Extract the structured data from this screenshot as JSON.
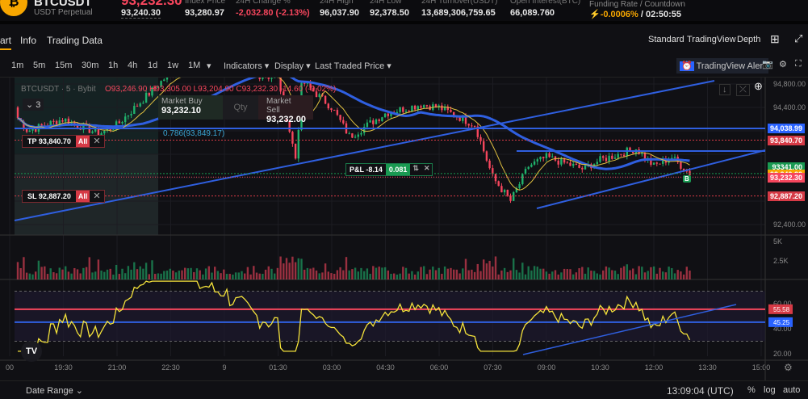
{
  "header": {
    "symbol": "BTCUSDT",
    "contract": "USDT Perpetual",
    "last_price": "93,232.30",
    "mark_price": "93,240.30",
    "stats": [
      {
        "label": "Index Price",
        "value": "93,280.97"
      },
      {
        "label": "24H Change %",
        "value": "-2,032.80 (-2.13%)"
      },
      {
        "label": "24H High",
        "value": "96,037.90"
      },
      {
        "label": "24H Low",
        "value": "92,378.50"
      },
      {
        "label": "24H Turnover(USDT)",
        "value": "13,689,306,759.65"
      },
      {
        "label": "Open Interest(BTC)",
        "value": "66,089.760"
      }
    ],
    "funding_label": "Funding Rate / Countdown",
    "funding_rate": "-0.0006%",
    "countdown": "/ 02:50:55"
  },
  "tabs": {
    "items": [
      "art",
      "Info",
      "Trading Data"
    ],
    "views": [
      "Standard",
      "TradingView",
      "Depth"
    ],
    "active_view": "TradingView"
  },
  "toolbar": {
    "intervals": [
      "1m",
      "5m",
      "15m",
      "30m",
      "1h",
      "4h",
      "1d",
      "1w",
      "1M"
    ],
    "active_interval": "5m",
    "menus": [
      "Indicators",
      "Display",
      "Last Traded Price"
    ],
    "alert": "TradingView Alert"
  },
  "legend": {
    "symbol": "BTCUSDT · 5 · Bybit",
    "ohlc": "O93,246.90 H93,305.00 L93,204.90 C93,232.30 -14.60 (-0.02%)",
    "collapse": "3"
  },
  "order": {
    "buy_label": "Market Buy",
    "buy_price": "93,232.10",
    "qty": "Qty",
    "sell_label": "Market Sell",
    "sell_price": "93,232.00"
  },
  "lines": {
    "fib": "0.786(93,849.17)",
    "tp": "TP 93,840.70",
    "sl": "SL 92,887.20",
    "all": "All",
    "pnl_label": "P&L -8.14",
    "pnl_qty": "0.081",
    "b_marker": "B"
  },
  "price_labels": [
    {
      "v": "94,038.99",
      "c": "#2962ff",
      "p": 94038.99
    },
    {
      "v": "93,840.70",
      "c": "#d63a46",
      "p": 93840.7
    },
    {
      "v": "93341.00",
      "c": "#1a9a52",
      "p": 93380
    },
    {
      "v": "93,240.30",
      "c": "#f7a600",
      "p": 93255
    },
    {
      "v": "93,232.30",
      "c": "#f6465d",
      "p": 93195
    },
    {
      "v": "92,887.20",
      "c": "#d63a46",
      "p": 92887.2
    }
  ],
  "colors": {
    "up": "#20b26c",
    "down": "#f6465d",
    "accent": "#f7a600",
    "trend": "#2f5fe0",
    "rsi": "#f5e33b"
  },
  "chart_data": {
    "type": "candlestick",
    "price_axis": {
      "ticks": [
        "94,800.00",
        "94,400.00",
        "92,400.00"
      ],
      "range": [
        92300,
        94900
      ]
    },
    "time_ticks": [
      "00",
      "19:30",
      "21:00",
      "22:30",
      "9",
      "01:30",
      "03:00",
      "04:30",
      "06:00",
      "07:30",
      "09:00",
      "10:30",
      "12:00",
      "13:30",
      "15:00"
    ],
    "approx_close": [
      [
        "18:00",
        94400
      ],
      [
        "18:30",
        94000
      ],
      [
        "19:30",
        94200
      ],
      [
        "20:30",
        93950
      ],
      [
        "21:00",
        94100
      ],
      [
        "22:00",
        94700
      ],
      [
        "22:30",
        95000
      ],
      [
        "00:00",
        95050
      ],
      [
        "01:30",
        94900
      ],
      [
        "02:00",
        93500
      ],
      [
        "02:10",
        94850
      ],
      [
        "03:00",
        94400
      ],
      [
        "03:30",
        93900
      ],
      [
        "04:30",
        94300
      ],
      [
        "05:30",
        94450
      ],
      [
        "06:00",
        94400
      ],
      [
        "07:00",
        94100
      ],
      [
        "07:30",
        93200
      ],
      [
        "08:00",
        92800
      ],
      [
        "08:30",
        93400
      ],
      [
        "09:00",
        93550
      ],
      [
        "10:00",
        93350
      ],
      [
        "10:30",
        93500
      ],
      [
        "11:30",
        93700
      ],
      [
        "12:00",
        93400
      ],
      [
        "12:30",
        93550
      ],
      [
        "13:05",
        93230
      ]
    ],
    "volume_ticks": [
      "5K",
      "2.5K"
    ],
    "rsi": {
      "ticks": [
        "60.00",
        "40.00",
        "20.00"
      ],
      "upper": 55.58,
      "lower": 45.25,
      "upper_label": "55.58",
      "lower_label": "45.25"
    }
  },
  "footer": {
    "date_range": "Date Range",
    "time": "13:09:04 (UTC)",
    "pct": "%",
    "log": "log",
    "auto": "auto"
  }
}
